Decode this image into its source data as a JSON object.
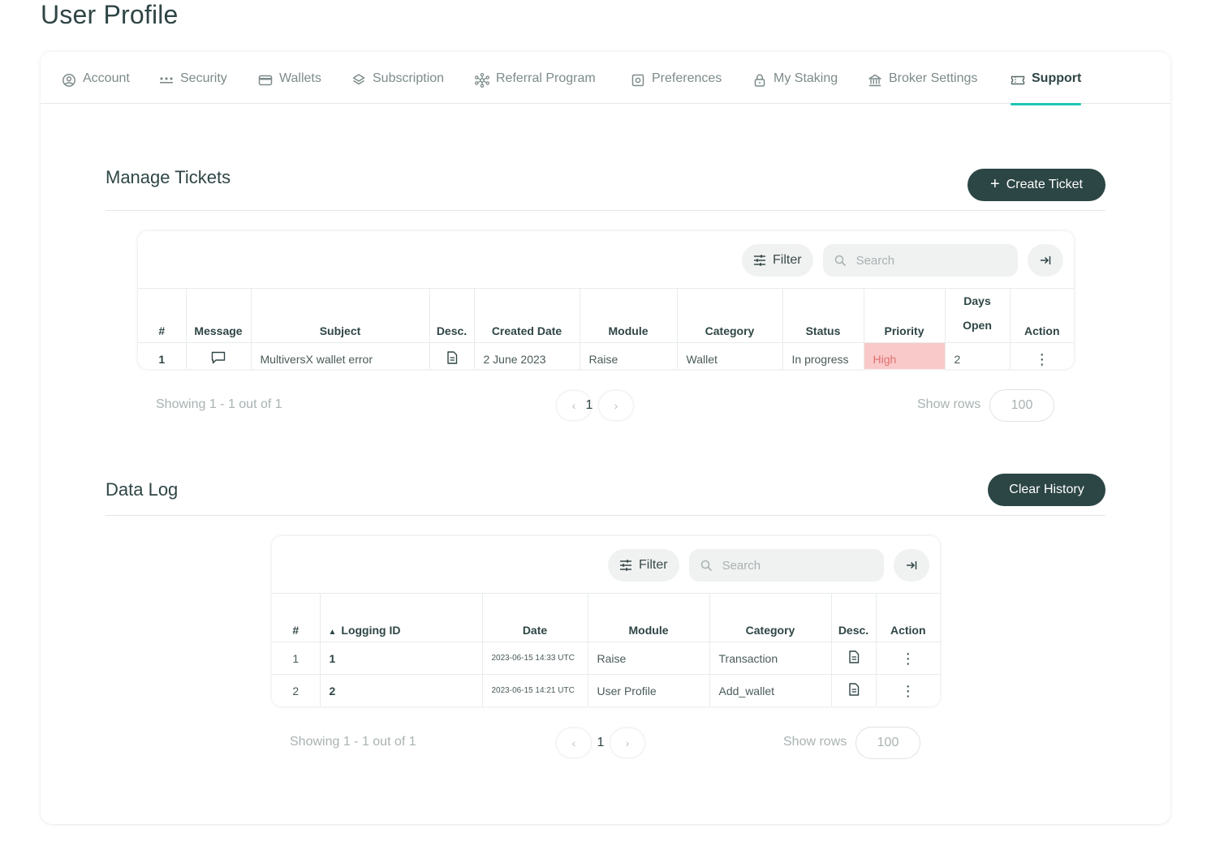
{
  "page_title": "User Profile",
  "tabs": [
    {
      "label": "Account",
      "icon": "user-circle-icon",
      "active": false
    },
    {
      "label": "Security",
      "icon": "password-dots-icon",
      "active": false
    },
    {
      "label": "Wallets",
      "icon": "wallet-icon",
      "active": false
    },
    {
      "label": "Subscription",
      "icon": "layers-icon",
      "active": false
    },
    {
      "label": "Referral Program",
      "icon": "network-icon",
      "active": false
    },
    {
      "label": "Preferences",
      "icon": "settings-square-icon",
      "active": false
    },
    {
      "label": "My Staking",
      "icon": "lock-icon",
      "active": false
    },
    {
      "label": "Broker Settings",
      "icon": "bank-icon",
      "active": false
    },
    {
      "label": "Support",
      "icon": "ticket-icon",
      "active": true
    }
  ],
  "tickets": {
    "title": "Manage Tickets",
    "create_label": "Create Ticket",
    "filter_label": "Filter",
    "search_placeholder": "Search",
    "columns": [
      "#",
      "Message",
      "Subject",
      "Desc.",
      "Created Date",
      "Module",
      "Category",
      "Status",
      "Priority",
      "Days Open",
      "Action"
    ],
    "columns_days_line1": "Days",
    "columns_days_line2": "Open",
    "rows": [
      {
        "num": "1",
        "subject": "MultiversX wallet error",
        "created": "2 June 2023",
        "module": "Raise",
        "category": "Wallet",
        "status": "In progress",
        "priority": "High",
        "days_open": "2"
      }
    ],
    "showing": "Showing 1 - 1 out of 1",
    "page": "1",
    "show_rows_label": "Show rows",
    "rows_per_page": "100"
  },
  "datalog": {
    "title": "Data Log",
    "clear_label": "Clear History",
    "filter_label": "Filter",
    "search_placeholder": "Search",
    "columns": [
      "#",
      "Logging ID",
      "Date",
      "Module",
      "Category",
      "Desc.",
      "Action"
    ],
    "rows": [
      {
        "num": "1",
        "logging_id": "1",
        "date": "2023-06-15 14:33 UTC",
        "module": "Raise",
        "category": "Transaction"
      },
      {
        "num": "2",
        "logging_id": "2",
        "date": "2023-06-15 14:21 UTC",
        "module": "User Profile",
        "category": "Add_wallet"
      }
    ],
    "showing": "Showing 1 - 1 out of 1",
    "page": "1",
    "show_rows_label": "Show rows",
    "rows_per_page": "100"
  },
  "colors": {
    "accent": "#1cc7b4",
    "dark_button": "#2c4545",
    "priority_high_bg": "#f9c9c9",
    "priority_high_text": "#e26f6f"
  }
}
